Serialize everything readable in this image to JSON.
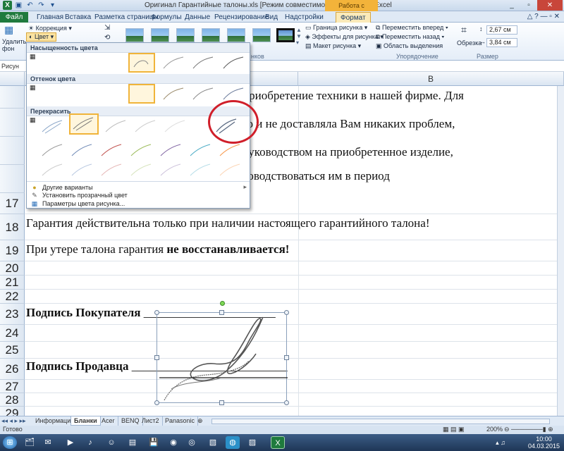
{
  "window": {
    "title": "Оригинал Гарантийные талоны.xls  [Режим совместимости]  -  Microsoft Excel",
    "context_tools": "Работа с рисунками",
    "controls": [
      "_",
      "▫",
      "✕"
    ]
  },
  "tabs": [
    "Файл",
    "Главная",
    "Вставка",
    "Разметка страницы",
    "Формулы",
    "Данные",
    "Рецензирование",
    "Вид",
    "Надстройки",
    "Формат"
  ],
  "ribbon": {
    "remove_bg": "Удалить фон",
    "correction": "Коррекция",
    "color": "Цвет",
    "border": "Граница рисунка",
    "effects": "Эффекты для рисунка",
    "layout": "Макет рисунка",
    "bring_forward": "Переместить вперед",
    "send_backward": "Переместить назад",
    "selection_pane": "Область выделения",
    "arrange_label": "Упорядочение",
    "crop": "Обрезка",
    "height": "2,67 см",
    "width": "3,84 см",
    "size_label": "Размер",
    "group_styles_partial": "нков"
  },
  "formula_bar": {
    "name_box": "Рисун"
  },
  "columns": [
    "B"
  ],
  "rows": [
    {
      "num": "17",
      "text": ""
    },
    {
      "num": "18",
      "text": "Гарантия действительна только при наличии настоящего гарантийного талона!"
    },
    {
      "num": "19",
      "text": "При утере талона гарантия ",
      "bold": "не восстанавливается!"
    },
    {
      "num": "20",
      "text": ""
    },
    {
      "num": "21",
      "text": ""
    },
    {
      "num": "22",
      "text": ""
    },
    {
      "num": "23",
      "bold": "Подпись Покупателя ",
      "text": "______________________"
    },
    {
      "num": "24",
      "text": ""
    },
    {
      "num": "25",
      "text": ""
    },
    {
      "num": "26",
      "bold": "Подпись Продавца ",
      "text": "__________________________"
    },
    {
      "num": "27",
      "text": ""
    },
    {
      "num": "28",
      "text": ""
    },
    {
      "num": "29",
      "text": ""
    }
  ],
  "visible_partial_lines": [
    "приобретение техники в нашей фирме. Для",
    "го и не доставляла Вам никаких проблем,",
    "руководством на приобретенное изделие,",
    "ководствоваться им в период"
  ],
  "dropdown": {
    "saturation_header": "Насыщенность цвета",
    "tone_header": "Оттенок цвета",
    "recolor_header": "Перекрасить",
    "more_variants": "Другие варианты",
    "set_transparent": "Установить прозрачный цвет",
    "color_options": "Параметры цвета рисунка..."
  },
  "sheet_tabs": [
    "Информация",
    "Бланки",
    "Acer",
    "BENQ",
    "Лист2",
    "Panasonic"
  ],
  "active_sheet": "Бланки",
  "status": {
    "ready": "Готово",
    "zoom": "200%"
  },
  "clock": {
    "time": "10:00",
    "date": "04.03.2015"
  },
  "accent": {
    "excel_green": "#1f7a3d",
    "context_orange": "#f3b33a",
    "annotation_red": "#d01f2a"
  }
}
